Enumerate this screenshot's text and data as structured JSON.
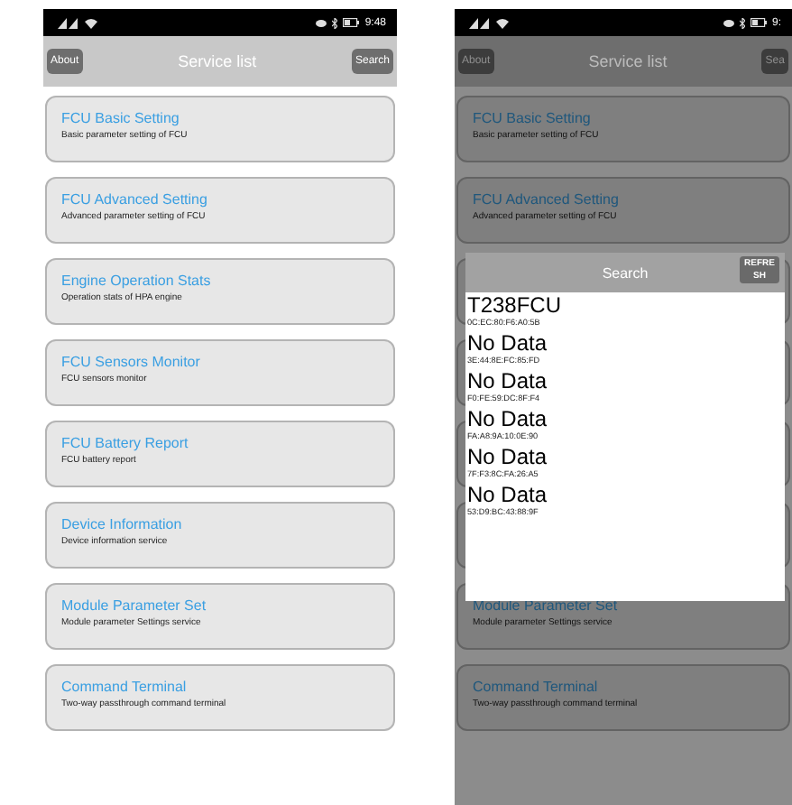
{
  "screens": [
    {
      "status_bar": {
        "time": "9:48"
      },
      "header": {
        "left_button": "About",
        "title": "Service list",
        "right_button": "Search"
      },
      "dimmed": false,
      "services": [
        {
          "kind": "card",
          "title": "FCU Basic Setting",
          "subtitle": "Basic parameter setting of FCU"
        },
        {
          "kind": "card",
          "title": "FCU Advanced Setting",
          "subtitle": "Advanced parameter setting of FCU"
        },
        {
          "kind": "card",
          "title": "Engine Operation Stats",
          "subtitle": "Operation stats of HPA engine"
        },
        {
          "kind": "card",
          "title": "FCU Sensors Monitor",
          "subtitle": "FCU sensors monitor"
        },
        {
          "kind": "card",
          "title": "FCU Battery Report",
          "subtitle": "FCU battery report"
        },
        {
          "kind": "card",
          "title": "Device Information",
          "subtitle": "Device information service"
        },
        {
          "kind": "card",
          "title": "Module Parameter Set",
          "subtitle": "Module parameter Settings service"
        },
        {
          "kind": "card",
          "title": "Command Terminal",
          "subtitle": "Two-way passthrough command terminal"
        }
      ]
    },
    {
      "status_bar": {
        "time": "9:"
      },
      "header": {
        "left_button": "About",
        "title": "Service list",
        "right_button": "Sea"
      },
      "dimmed": true,
      "services": [
        {
          "kind": "card",
          "title": "FCU Basic Setting",
          "subtitle": "Basic parameter setting of FCU"
        },
        {
          "kind": "card",
          "title": "FCU Advanced Setting",
          "subtitle": "Advanced parameter setting of FCU"
        },
        {
          "kind": "covered"
        },
        {
          "kind": "covered"
        },
        {
          "kind": "covered"
        },
        {
          "kind": "covered"
        },
        {
          "kind": "card",
          "title": "Module Parameter Set",
          "subtitle": "Module parameter Settings service"
        },
        {
          "kind": "card",
          "title": "Command Terminal",
          "subtitle": "Two-way passthrough command terminal"
        }
      ],
      "dialog": {
        "title": "Search",
        "button": "REFRESH",
        "devices": [
          {
            "name": "T238FCU",
            "address": "0C:EC:80:F6:A0:5B"
          },
          {
            "name": "No Data",
            "address": "3E:44:8E:FC:85:FD"
          },
          {
            "name": "No Data",
            "address": "F0:FE:59:DC:8F:F4"
          },
          {
            "name": "No Data",
            "address": "FA:A8:9A:10:0E:90"
          },
          {
            "name": "No Data",
            "address": "7F:F3:8C:FA:26:A5"
          },
          {
            "name": "No Data",
            "address": "53:D9:BC:43:88:9F"
          }
        ]
      }
    }
  ]
}
